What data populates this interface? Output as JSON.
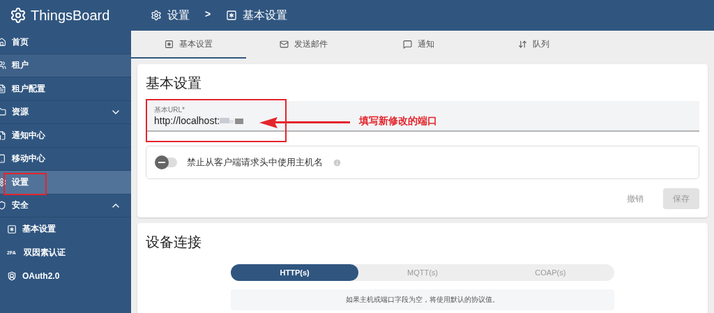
{
  "header": {
    "app_name": "ThingsBoard",
    "separator": ">",
    "breadcrumbs": [
      {
        "label": "设置"
      },
      {
        "label": "基本设置"
      }
    ]
  },
  "sidebar": {
    "items": [
      {
        "label": "首页",
        "kind": "item",
        "selected": false,
        "hovered": false
      },
      {
        "label": "租户",
        "kind": "item",
        "selected": false,
        "hovered": true
      },
      {
        "label": "租户配置",
        "kind": "item",
        "selected": false,
        "hovered": false
      },
      {
        "label": "资源",
        "kind": "group",
        "selected": false,
        "hovered": false,
        "expanded": false
      },
      {
        "label": "通知中心",
        "kind": "item",
        "selected": false,
        "hovered": false
      },
      {
        "label": "移动中心",
        "kind": "item",
        "selected": false,
        "hovered": false
      },
      {
        "label": "设置",
        "kind": "item",
        "selected": true,
        "hovered": false
      },
      {
        "label": "安全",
        "kind": "group",
        "selected": false,
        "hovered": false,
        "expanded": true,
        "children": [
          {
            "label": "基本设置",
            "selected": false
          },
          {
            "label": "双因素认证",
            "selected": false,
            "icon_text": "2FA"
          },
          {
            "label": "OAuth2.0",
            "selected": false
          }
        ]
      }
    ]
  },
  "tabs": [
    {
      "label": "基本设置",
      "selected": true
    },
    {
      "label": "发送邮件",
      "selected": false
    },
    {
      "label": "通知",
      "selected": false
    },
    {
      "label": "队列",
      "selected": false
    }
  ],
  "general_card": {
    "title": "基本设置",
    "url_field": {
      "label": "基本URL*",
      "value": "http://localhost:"
    },
    "hostname_toggle": {
      "label": "禁止从客户端请求头中使用主机名",
      "on": false
    },
    "buttons": [
      {
        "label": "撤销",
        "kind": "text",
        "disabled": true
      },
      {
        "label": "保存",
        "kind": "raised",
        "disabled": true
      }
    ]
  },
  "annotation": {
    "text": "填写新修改的端口"
  },
  "connectivity_card": {
    "title": "设备连接",
    "protocols": [
      {
        "label": "HTTP(s)",
        "selected": true
      },
      {
        "label": "MQTT(s)",
        "selected": false
      },
      {
        "label": "COAP(s)",
        "selected": false
      }
    ],
    "hint": "如果主机或端口字段为空，将使用默认的协议值。"
  }
}
